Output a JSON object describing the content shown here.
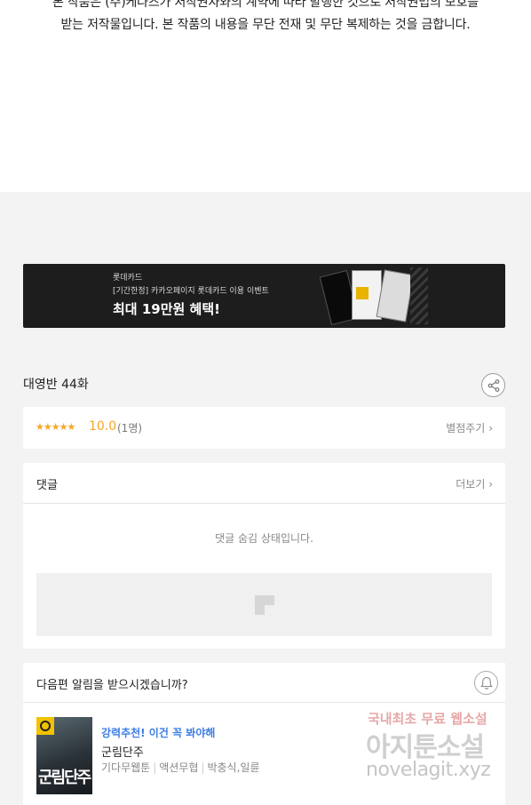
{
  "notice": {
    "line1": "본 작품은 (주)케나즈가 저작권자와의 계약에 따라 발행한 것으로 저작권법의 보호를",
    "line2": "받는 저작물입니다. 본 작품의 내용을 무단 전재 및 무단 복제하는 것을 금합니다."
  },
  "banner": {
    "brand": "롯데카드",
    "subtitle": "[기간한정] 카카오페이지 롯데카드 이용 이벤트",
    "headline": "최대 19만원 혜택!"
  },
  "episode": {
    "title": "대영반 44화",
    "share_icon": "share-icon"
  },
  "rating": {
    "stars": "★★★★★",
    "score": "10.0",
    "count": "(1명)",
    "rate_button": "별점주기",
    "chevron": "›"
  },
  "comments": {
    "title": "댓글",
    "more": "더보기",
    "chevron": "›",
    "hidden_message": "댓글 숨김 상태입니다."
  },
  "notify": {
    "title": "다음편 알림을 받으시겠습니까?",
    "bell_icon": "bell-icon"
  },
  "recommendation": {
    "tag": "강력추천! 이건 꼭 봐야해",
    "name": "군림단주",
    "thumb_title": "군림단주",
    "meta": [
      "기다무웹툰",
      "액션무협",
      "박충식,일륜"
    ]
  },
  "watermark": {
    "line1": "국내최초 무료 웹소설",
    "line2": "아지툰소설",
    "line3": "novelagit.xyz"
  },
  "colors": {
    "accent_star": "#f6a623",
    "tag_blue": "#3c7de6",
    "banner_bg": "#1e1d1d",
    "page_bg": "#f3f3f3"
  }
}
